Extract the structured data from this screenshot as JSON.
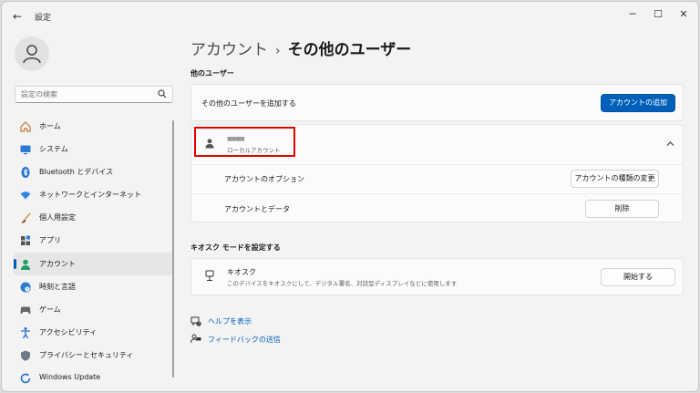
{
  "window": {
    "title": "設定",
    "back_glyph": "←",
    "minimize_glyph": "─",
    "maximize_glyph": "☐",
    "close_glyph": "✕"
  },
  "search": {
    "placeholder": "設定の検索"
  },
  "sidebar": {
    "items": [
      {
        "label": "ホーム",
        "icon": "home-icon"
      },
      {
        "label": "システム",
        "icon": "monitor-icon"
      },
      {
        "label": "Bluetooth とデバイス",
        "icon": "bluetooth-icon"
      },
      {
        "label": "ネットワークとインターネット",
        "icon": "wifi-icon"
      },
      {
        "label": "個人用設定",
        "icon": "brush-icon"
      },
      {
        "label": "アプリ",
        "icon": "apps-icon"
      },
      {
        "label": "アカウント",
        "icon": "account-icon",
        "active": true
      },
      {
        "label": "時刻と言語",
        "icon": "globe-clock-icon"
      },
      {
        "label": "ゲーム",
        "icon": "gamepad-icon"
      },
      {
        "label": "アクセシビリティ",
        "icon": "accessibility-icon"
      },
      {
        "label": "プライバシーとセキュリティ",
        "icon": "shield-icon"
      },
      {
        "label": "Windows Update",
        "icon": "update-icon"
      }
    ]
  },
  "breadcrumb": {
    "parent": "アカウント",
    "separator": "›",
    "current": "その他のユーザー"
  },
  "other_users": {
    "title": "他のユーザー",
    "add_label": "その他のユーザーを追加する",
    "add_button": "アカウントの追加",
    "user": {
      "name": "■■■■",
      "type": "ローカルアカウント",
      "options_label": "アカウントのオプション",
      "change_type_button": "アカウントの種類の変更",
      "data_label": "アカウントとデータ",
      "delete_button": "削除"
    }
  },
  "kiosk": {
    "title": "キオスク モードを設定する",
    "label": "キオスク",
    "description": "このデバイスをキオスクにして、デジタル署名、対話型ディスプレイなどに使用します",
    "button": "開始する"
  },
  "links": {
    "help": "ヘルプを表示",
    "feedback": "フィードバックの送信"
  },
  "colors": {
    "accent": "#005fb8",
    "highlight_box": "#e00000"
  }
}
